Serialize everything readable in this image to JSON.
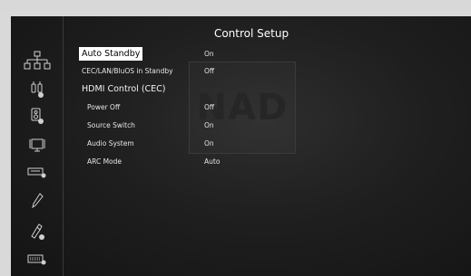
{
  "page": {
    "title": "Control Setup"
  },
  "sidebar": {
    "items": [
      {
        "icon": "network-icon"
      },
      {
        "icon": "audio-input-icon"
      },
      {
        "icon": "speaker-settings-icon"
      },
      {
        "icon": "display-icon"
      },
      {
        "icon": "remote-icon"
      },
      {
        "icon": "pen-icon"
      },
      {
        "icon": "tools-icon"
      },
      {
        "icon": "keyboard-icon"
      }
    ]
  },
  "watermark": {
    "text": "NAD"
  },
  "settings": [
    {
      "label": "Auto Standby",
      "value": "On",
      "selected": true
    },
    {
      "label": "CEC/LAN/BluOS in Standby",
      "value": "Off"
    },
    {
      "label": "HDMI Control (CEC)",
      "value": ""
    },
    {
      "label": "Power Off",
      "value": "Off"
    },
    {
      "label": "Source Switch",
      "value": "On"
    },
    {
      "label": "Audio System",
      "value": "On"
    },
    {
      "label": "ARC Mode",
      "value": "Auto"
    }
  ],
  "colors": {
    "background": "#1f1f1f",
    "selected_bg": "#ffffff",
    "text": "#e6e6e6"
  }
}
